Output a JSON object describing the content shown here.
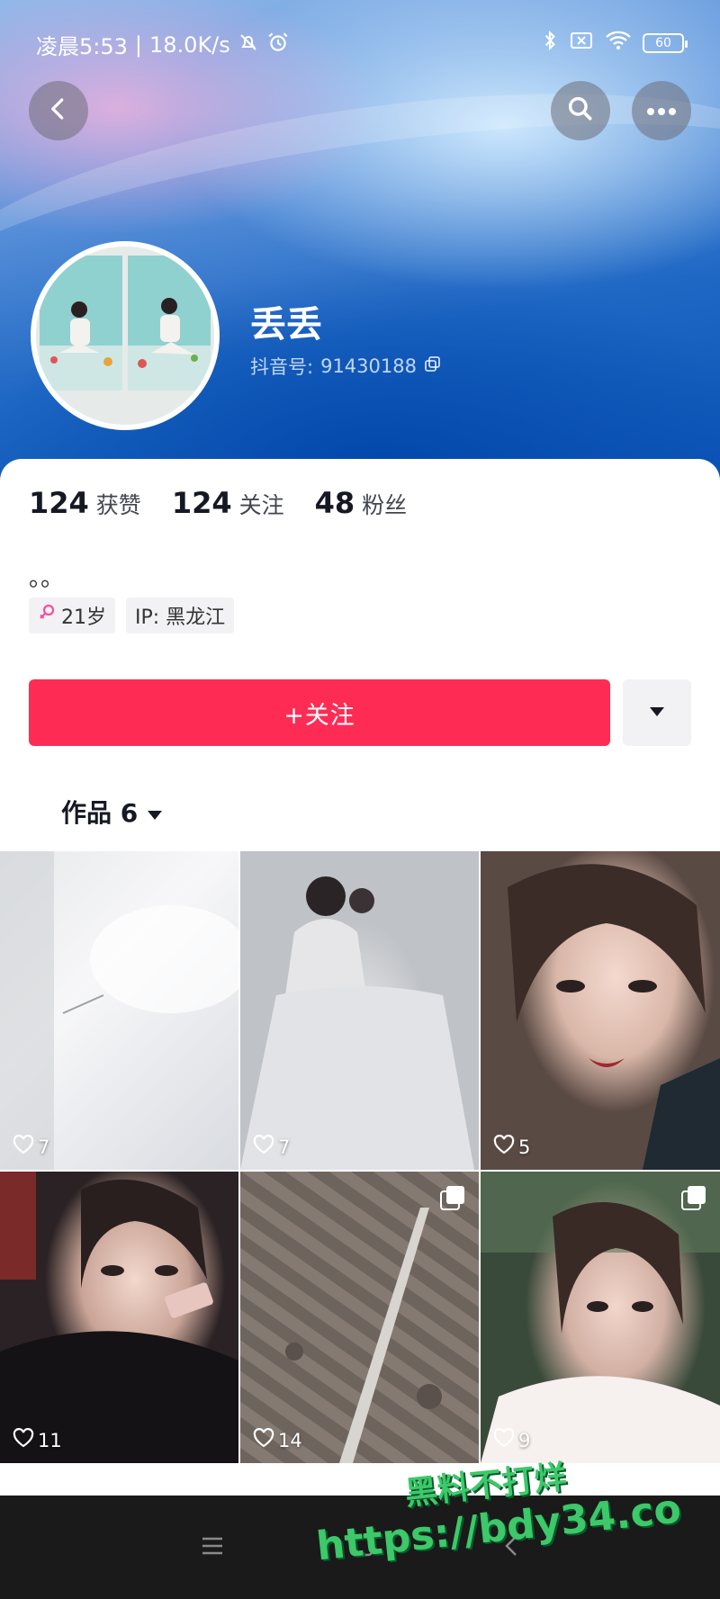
{
  "status_bar": {
    "time": "凌晨5:53",
    "speed": "18.0K/s",
    "battery": "60"
  },
  "profile": {
    "name": "丢丢",
    "id_label": "抖音号:",
    "id_value": "91430188"
  },
  "stats": [
    {
      "value": "124",
      "label": "获赞"
    },
    {
      "value": "124",
      "label": "关注"
    },
    {
      "value": "48",
      "label": "粉丝"
    }
  ],
  "bio": "。。",
  "tags": {
    "age": "21岁",
    "ip": "IP: 黑龙江"
  },
  "follow_button": "+关注",
  "tabs": {
    "works_label": "作品 6"
  },
  "videos": [
    {
      "likes": "7"
    },
    {
      "likes": "7"
    },
    {
      "likes": "5"
    },
    {
      "likes": "11"
    },
    {
      "likes": "14"
    },
    {
      "likes": "9"
    }
  ],
  "watermark": {
    "line1": "黑料不打烊",
    "line2": "https://bdy34.co"
  },
  "colors": {
    "accent": "#fe2c55",
    "header_blue": "#1f68c4"
  }
}
